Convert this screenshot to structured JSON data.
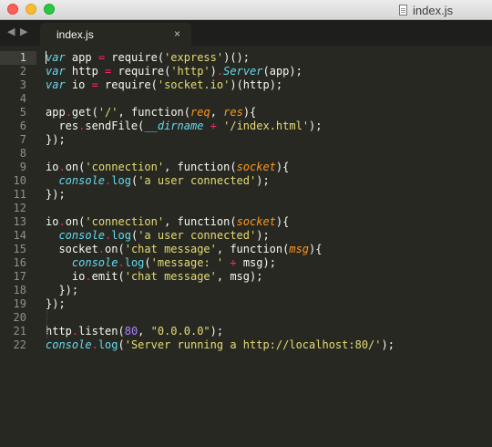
{
  "window": {
    "title": "index.js",
    "file_icon": "document-icon"
  },
  "nav": {
    "back_icon": "◀",
    "forward_icon": "▶"
  },
  "tab": {
    "label": "index.js",
    "close_icon": "×"
  },
  "editor": {
    "active_line": 1,
    "lines": [
      {
        "n": "1",
        "tokens": [
          [
            "keyword",
            "var"
          ],
          [
            "plain",
            " app "
          ],
          [
            "op",
            "="
          ],
          [
            "plain",
            " require("
          ],
          [
            "string",
            "'express'"
          ],
          [
            "plain",
            ")();"
          ]
        ]
      },
      {
        "n": "2",
        "tokens": [
          [
            "keyword",
            "var"
          ],
          [
            "plain",
            " http "
          ],
          [
            "op",
            "="
          ],
          [
            "plain",
            " require("
          ],
          [
            "string",
            "'http'"
          ],
          [
            "plain",
            ")"
          ],
          [
            "dot",
            "."
          ],
          [
            "support",
            "Server"
          ],
          [
            "plain",
            "(app);"
          ]
        ]
      },
      {
        "n": "3",
        "tokens": [
          [
            "keyword",
            "var"
          ],
          [
            "plain",
            " io "
          ],
          [
            "op",
            "="
          ],
          [
            "plain",
            " require("
          ],
          [
            "string",
            "'socket.io'"
          ],
          [
            "plain",
            ")(http);"
          ]
        ]
      },
      {
        "n": "4",
        "tokens": []
      },
      {
        "n": "5",
        "tokens": [
          [
            "plain",
            "app"
          ],
          [
            "dot",
            "."
          ],
          [
            "plain",
            "get("
          ],
          [
            "string",
            "'/'"
          ],
          [
            "plain",
            ", "
          ],
          [
            "func_kw",
            "function"
          ],
          [
            "plain",
            "("
          ],
          [
            "param",
            "req"
          ],
          [
            "plain",
            ", "
          ],
          [
            "param",
            "res"
          ],
          [
            "plain",
            "){"
          ]
        ]
      },
      {
        "n": "6",
        "tokens": [
          [
            "plain",
            "  res"
          ],
          [
            "dot",
            "."
          ],
          [
            "plain",
            "sendFile("
          ],
          [
            "support",
            "__dirname"
          ],
          [
            "plain",
            " "
          ],
          [
            "op",
            "+"
          ],
          [
            "plain",
            " "
          ],
          [
            "string",
            "'/index.html'"
          ],
          [
            "plain",
            ");"
          ]
        ]
      },
      {
        "n": "7",
        "tokens": [
          [
            "plain",
            "});"
          ]
        ]
      },
      {
        "n": "8",
        "tokens": []
      },
      {
        "n": "9",
        "tokens": [
          [
            "plain",
            "io"
          ],
          [
            "dot",
            "."
          ],
          [
            "plain",
            "on("
          ],
          [
            "string",
            "'connection'"
          ],
          [
            "plain",
            ", "
          ],
          [
            "func_kw",
            "function"
          ],
          [
            "plain",
            "("
          ],
          [
            "param",
            "socket"
          ],
          [
            "plain",
            "){"
          ]
        ]
      },
      {
        "n": "10",
        "tokens": [
          [
            "plain",
            "  "
          ],
          [
            "support",
            "console"
          ],
          [
            "dot",
            "."
          ],
          [
            "method",
            "log"
          ],
          [
            "plain",
            "("
          ],
          [
            "string",
            "'a user connected'"
          ],
          [
            "plain",
            ");"
          ]
        ]
      },
      {
        "n": "11",
        "tokens": [
          [
            "plain",
            "});"
          ]
        ]
      },
      {
        "n": "12",
        "tokens": []
      },
      {
        "n": "13",
        "tokens": [
          [
            "plain",
            "io"
          ],
          [
            "dot",
            "."
          ],
          [
            "plain",
            "on("
          ],
          [
            "string",
            "'connection'"
          ],
          [
            "plain",
            ", "
          ],
          [
            "func_kw",
            "function"
          ],
          [
            "plain",
            "("
          ],
          [
            "param",
            "socket"
          ],
          [
            "plain",
            "){"
          ]
        ]
      },
      {
        "n": "14",
        "tokens": [
          [
            "plain",
            "  "
          ],
          [
            "support",
            "console"
          ],
          [
            "dot",
            "."
          ],
          [
            "method",
            "log"
          ],
          [
            "plain",
            "("
          ],
          [
            "string",
            "'a user connected'"
          ],
          [
            "plain",
            ");"
          ]
        ]
      },
      {
        "n": "15",
        "tokens": [
          [
            "plain",
            "  socket"
          ],
          [
            "dot",
            "."
          ],
          [
            "plain",
            "on("
          ],
          [
            "string",
            "'chat message'"
          ],
          [
            "plain",
            ", "
          ],
          [
            "func_kw",
            "function"
          ],
          [
            "plain",
            "("
          ],
          [
            "param",
            "msg"
          ],
          [
            "plain",
            "){"
          ]
        ]
      },
      {
        "n": "16",
        "tokens": [
          [
            "plain",
            "    "
          ],
          [
            "support",
            "console"
          ],
          [
            "dot",
            "."
          ],
          [
            "method",
            "log"
          ],
          [
            "plain",
            "("
          ],
          [
            "string",
            "'message: '"
          ],
          [
            "plain",
            " "
          ],
          [
            "op",
            "+"
          ],
          [
            "plain",
            " msg);"
          ]
        ]
      },
      {
        "n": "17",
        "tokens": [
          [
            "plain",
            "    io"
          ],
          [
            "dot",
            "."
          ],
          [
            "plain",
            "emit("
          ],
          [
            "string",
            "'chat message'"
          ],
          [
            "plain",
            ", msg);"
          ]
        ]
      },
      {
        "n": "18",
        "tokens": [
          [
            "plain",
            "  });"
          ]
        ]
      },
      {
        "n": "19",
        "tokens": [
          [
            "plain",
            "});"
          ]
        ]
      },
      {
        "n": "20",
        "tokens": []
      },
      {
        "n": "21",
        "tokens": [
          [
            "plain",
            "http"
          ],
          [
            "dot",
            "."
          ],
          [
            "plain",
            "listen("
          ],
          [
            "number",
            "80"
          ],
          [
            "plain",
            ", "
          ],
          [
            "string",
            "\"0.0.0.0\""
          ],
          [
            "plain",
            ");"
          ]
        ]
      },
      {
        "n": "22",
        "tokens": [
          [
            "support",
            "console"
          ],
          [
            "dot",
            "."
          ],
          [
            "method",
            "log"
          ],
          [
            "plain",
            "("
          ],
          [
            "string",
            "'Server running a http://localhost:80/'"
          ],
          [
            "plain",
            ");"
          ]
        ]
      }
    ]
  },
  "colors": {
    "background": "#272822",
    "foreground": "#f8f8f2",
    "keyword": "#66d9ef",
    "string": "#e6db74",
    "number": "#ae81ff",
    "parameter": "#fd971f",
    "operator": "#f92672"
  }
}
